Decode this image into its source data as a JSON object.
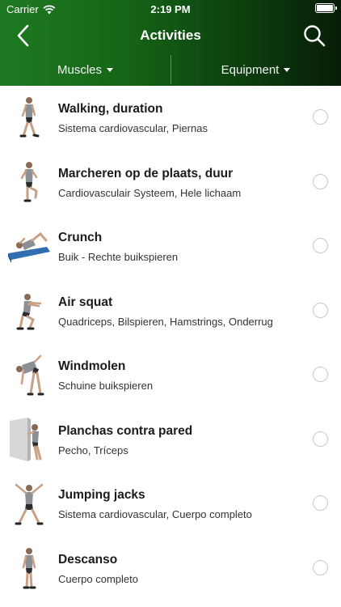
{
  "status": {
    "carrier": "Carrier",
    "time": "2:19 PM"
  },
  "nav": {
    "title": "Activities",
    "back_icon": "chevron-left-icon",
    "search_icon": "search-icon"
  },
  "filters": [
    {
      "label": "Muscles"
    },
    {
      "label": "Equipment"
    }
  ],
  "colors": {
    "header_start": "#1f7a22",
    "header_end": "#061d07",
    "radio_border": "#c8c8c8"
  },
  "exercises": [
    {
      "name": "Walking, duration",
      "muscles": "Sistema cardiovascular, Piernas",
      "icon": "walking-figure-icon",
      "selected": false
    },
    {
      "name": "Marcheren op de plaats, duur",
      "muscles": "Cardiovasculair Systeem, Hele lichaam",
      "icon": "marching-figure-icon",
      "selected": false
    },
    {
      "name": "Crunch",
      "muscles": "Buik - Rechte buikspieren",
      "icon": "crunch-figure-icon",
      "selected": false
    },
    {
      "name": "Air squat",
      "muscles": "Quadriceps, Bilspieren, Hamstrings, Onderrug",
      "icon": "squat-figure-icon",
      "selected": false
    },
    {
      "name": "Windmolen",
      "muscles": "Schuine buikspieren",
      "icon": "windmill-figure-icon",
      "selected": false
    },
    {
      "name": "Planchas contra pared",
      "muscles": "Pecho, Tríceps",
      "icon": "wall-pushup-figure-icon",
      "selected": false
    },
    {
      "name": "Jumping jacks",
      "muscles": "Sistema cardiovascular, Cuerpo completo",
      "icon": "jumping-jacks-figure-icon",
      "selected": false
    },
    {
      "name": "Descanso",
      "muscles": "Cuerpo completo",
      "icon": "resting-figure-icon",
      "selected": false
    }
  ]
}
